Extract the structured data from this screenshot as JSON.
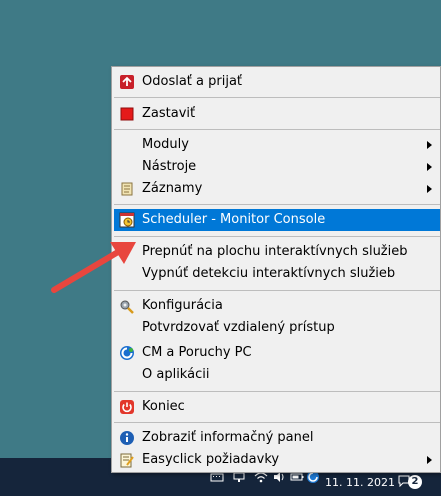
{
  "context_menu": {
    "items": [
      {
        "label": "Odoslať a prijať",
        "icon": "send-receive-icon"
      },
      {
        "label": "Zastaviť",
        "icon": "stop-icon"
      },
      {
        "label": "Moduly",
        "submenu": true
      },
      {
        "label": "Nástroje",
        "submenu": true
      },
      {
        "label": "Záznamy",
        "icon": "log-scroll-icon",
        "submenu": true
      },
      {
        "label": "Scheduler - Monitor Console",
        "icon": "scheduler-icon",
        "highlighted": true
      },
      {
        "label": "Prepnúť na plochu interaktívnych služieb"
      },
      {
        "label": "Vypnúť detekciu interaktívnych služieb"
      },
      {
        "label": "Konfigurácia",
        "icon": "configuration-icon"
      },
      {
        "label": "Potvrdzovať vzdialený prístup"
      },
      {
        "label": "CM a Poruchy PC",
        "icon": "cm-globe-icon"
      },
      {
        "label": "O aplikácii"
      },
      {
        "label": "Koniec",
        "icon": "exit-power-icon"
      },
      {
        "label": "Zobraziť informačný panel",
        "icon": "info-icon"
      },
      {
        "label": "Easyclick požiadavky",
        "icon": "notepad-edit-icon",
        "submenu": true
      }
    ]
  },
  "taskbar": {
    "date": "11. 11. 2021",
    "notification_count": "2"
  },
  "colors": {
    "desktop": "#3f7a86",
    "taskbar": "#15253b",
    "menu_bg": "#f0f0f0",
    "highlight": "#0078d7",
    "annotation_arrow": "#e8463e"
  }
}
